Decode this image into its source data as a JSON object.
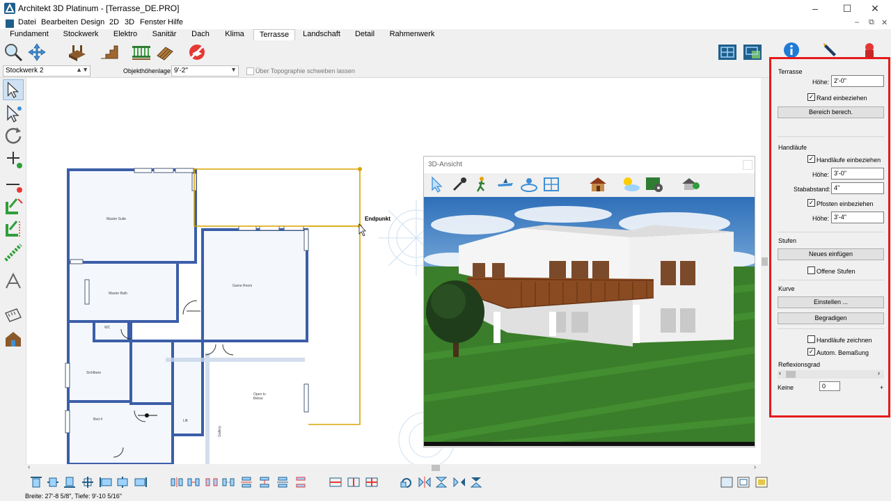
{
  "window": {
    "title": "Architekt 3D Platinum - [Terrasse_DE.PRO]",
    "minimize": "–",
    "maximize": "☐",
    "close": "✕",
    "mdi_min": "–",
    "mdi_restore": "⧉",
    "mdi_close": "✕"
  },
  "menu": [
    "Datei",
    "Bearbeiten",
    "Design",
    "2D",
    "3D",
    "Fenster",
    "Hilfe"
  ],
  "tabs": [
    "Fundament",
    "Stockwerk",
    "Elektro",
    "Sanitär",
    "Dach",
    "Klima",
    "Terrasse",
    "Landschaft",
    "Detail",
    "Rahmenwerk"
  ],
  "active_tab": "Terrasse",
  "toolbar2": {
    "stockwerk": "Stockwerk 2",
    "objekthoehe_label": "Objekthöhenlage:",
    "objekthoehe_value": "9'-2\"",
    "topo_label": "Über Topographie schweben lassen"
  },
  "plan": {
    "endpunkt": "Endpunkt",
    "rooms": [
      "Master Suite",
      "Master Bath",
      "WC",
      "Game Room",
      "Sichtbare",
      "Open to Below",
      "Bed 4",
      "Lift",
      "Gallery"
    ]
  },
  "view3d": {
    "title": "3D-Ansicht"
  },
  "status": "Breite: 27'-8 5/8\", Tiefe: 9'-10 5/16\"",
  "panel": {
    "terrasse_header": "Terrasse",
    "hoehe_label": "Höhe:",
    "hoehe_value": "2'-0\"",
    "rand_label": "Rand einbeziehen",
    "bereich_btn": "Bereich berech.",
    "handlaeufe_header": "Handläufe",
    "handlaeufe_label": "Handläufe einbeziehen",
    "hl_hoehe_label": "Höhe:",
    "hl_hoehe_value": "3'-0\"",
    "stababstand_label": "Stababstand:",
    "stababstand_value": "4\"",
    "pfosten_label": "Pfosten einbeziehen",
    "pf_hoehe_label": "Höhe:",
    "pf_hoehe_value": "3'-4\"",
    "stufen_header": "Stufen",
    "neues_btn": "Neues einfügen",
    "offene_label": "Offene Stufen",
    "kurve_header": "Kurve",
    "einstellen_btn": "Einstellen ...",
    "begradigen_btn": "Begradigen",
    "hl_zeichnen_label": "Handläufe zeichnen",
    "autom_label": "Autom. Bemaßung",
    "reflexion_header": "Reflexionsgrad",
    "keine_label": "Keine",
    "reflexion_value": "0",
    "plus": "+",
    "check": "✓"
  },
  "colors": {
    "highlight": "#e41b1b",
    "accent": "#1f5f8b",
    "selection": "#d9a400"
  }
}
